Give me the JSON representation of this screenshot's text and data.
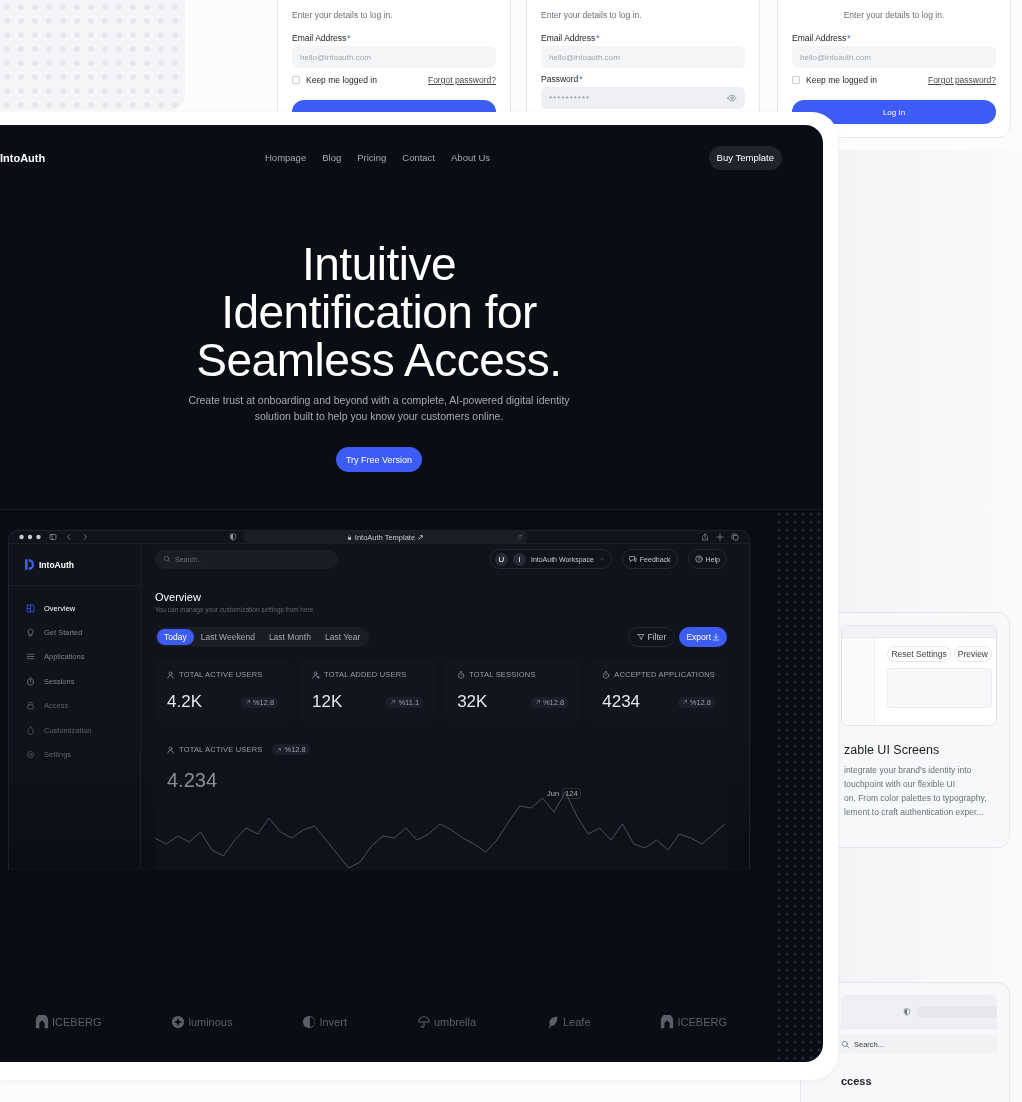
{
  "login_cards": [
    {
      "subtitle": "Enter your details to log in.",
      "fields": [
        {
          "kind": "email",
          "label": "Email Address",
          "required_mark": "*",
          "placeholder": "hello@intoauth.com"
        }
      ],
      "remember": {
        "label": "Keep me logged in",
        "checked": false
      },
      "forgot": "Forgot password?",
      "show_button": true
    },
    {
      "subtitle": "Enter your details to log in.",
      "fields": [
        {
          "kind": "email",
          "label": "Email Address",
          "required_mark": "*",
          "placeholder": "hello@intoauth.com"
        },
        {
          "kind": "password",
          "label": "Password",
          "required_mark": "*",
          "value": "**********"
        }
      ],
      "show_button": false
    },
    {
      "subtitle": "Enter your details to log in.",
      "fields": [
        {
          "kind": "email",
          "label": "Email Address",
          "required_mark": "*",
          "placeholder": "hello@intoauth.com"
        }
      ],
      "remember": {
        "label": "Keep me logged in",
        "checked": false
      },
      "forgot": "Forgot password?",
      "show_button": true,
      "button_label": "Log In"
    }
  ],
  "nav": {
    "brand": "IntoAuth",
    "links": [
      "Hompage",
      "Blog",
      "Pricing",
      "Contact",
      "About Us"
    ],
    "button": "Buy Template"
  },
  "hero": {
    "title_lines": [
      "Intuitive",
      "Identification for",
      "Seamless Access."
    ],
    "subtitle_lines": [
      "Create trust at onboarding and beyond with a complete, AI-powered digital identity",
      "solution built to help you know your customers online."
    ],
    "cta": "Try Free Version"
  },
  "dashboard": {
    "url": "IntoAuth Template ↗",
    "sidebar": {
      "brand": "IntoAuth",
      "items": [
        {
          "label": "Overview",
          "kind": "grid",
          "selected": true
        },
        {
          "label": "Get Started",
          "kind": "bulb",
          "selected": false
        },
        {
          "label": "Applications",
          "kind": "list",
          "selected": false
        },
        {
          "label": "Sessions",
          "kind": "timer",
          "selected": false
        },
        {
          "label": "Access",
          "kind": "lock",
          "selected": false
        },
        {
          "label": "Customization",
          "kind": "drop",
          "selected": false
        },
        {
          "label": "Settings",
          "kind": "gear",
          "selected": false
        }
      ]
    },
    "search": {
      "placeholder": "Search.."
    },
    "workspace": {
      "avatars": [
        "U",
        "I"
      ],
      "name": "IntoAuth Workspace"
    },
    "actions": [
      {
        "label": "Feedback",
        "kind": "feedback"
      },
      {
        "label": "Help",
        "kind": "help"
      }
    ],
    "heading": "Overview",
    "subheading": "You can manage your customization settings from here.",
    "periods": [
      {
        "label": "Today",
        "selected": true
      },
      {
        "label": "Last Weekend",
        "selected": false
      },
      {
        "label": "Last Month",
        "selected": false
      },
      {
        "label": "Last Year",
        "selected": false
      }
    ],
    "filter": "Filter",
    "export": "Export",
    "stats": [
      {
        "label": "TOTAL ACTIVE USERS",
        "kind": "user",
        "value": "4.2K",
        "delta": "%12.8"
      },
      {
        "label": "TOTAL ADDED USERS",
        "kind": "user-plus",
        "value": "12K",
        "delta": "%11.1"
      },
      {
        "label": "TOTAL SESSIONS",
        "kind": "timer",
        "value": "32K",
        "delta": "%12.8"
      },
      {
        "label": "ACCEPTED APPLICATIONS",
        "kind": "timer",
        "value": "4234",
        "delta": "%12.8"
      }
    ],
    "chart": {
      "label": "TOTAL ACTIVE USERS",
      "delta": "%12.8",
      "value": "4.234",
      "tooltip": {
        "month": "Jun",
        "value": "124"
      }
    }
  },
  "logos": [
    {
      "name": "ICEBERG",
      "kind": "arch"
    },
    {
      "name": "luminous",
      "kind": "star"
    },
    {
      "name": "Invert",
      "kind": "half"
    },
    {
      "name": "umbrella",
      "kind": "umbrella"
    },
    {
      "name": "Leafe",
      "kind": "leaf"
    },
    {
      "name": "ICEBERG",
      "kind": "arch"
    }
  ],
  "feature_card": {
    "buttons": [
      "Reset Settings",
      "Preview"
    ],
    "title": "zable UI Screens",
    "lines": [
      "integrate your brand's identity into",
      "touchpoint with our flexible UI",
      "on. From color palettes to typography,",
      "lement to craft authentication exper..."
    ]
  },
  "preview_card": {
    "search_placeholder": "Search...",
    "heading": "ccess"
  }
}
